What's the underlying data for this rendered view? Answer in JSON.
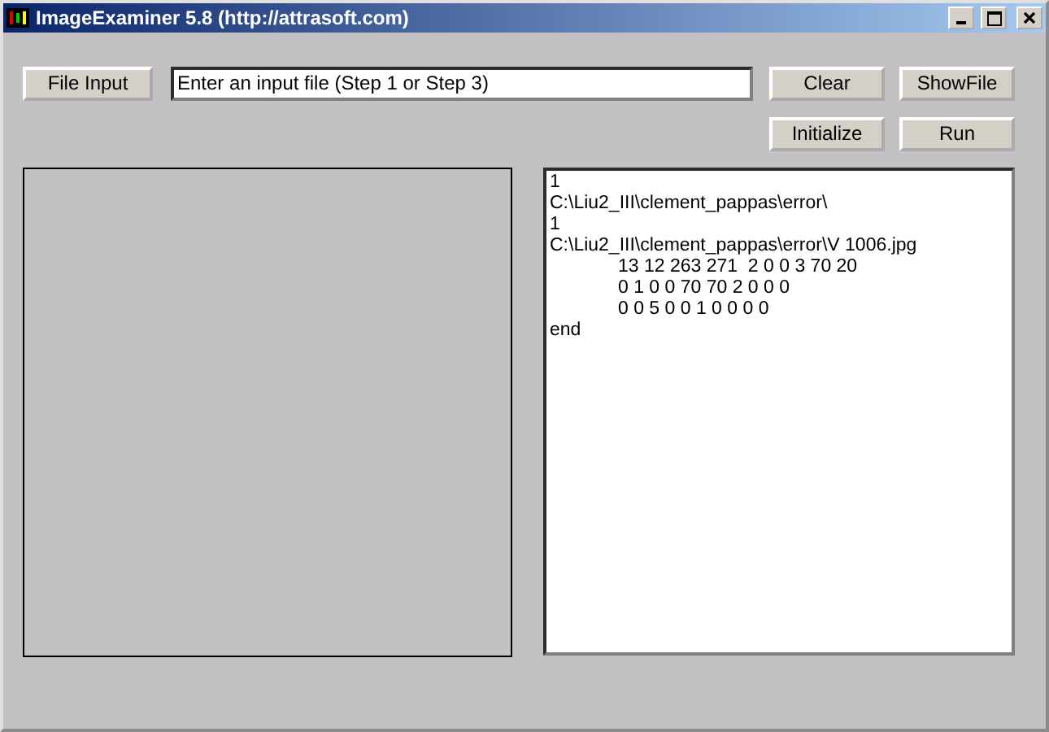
{
  "window": {
    "title": "ImageExaminer 5.8 (http://attrasoft.com)"
  },
  "file_input_button": "File Input",
  "input_field": {
    "value": "Enter an input file (Step 1 or Step 3)"
  },
  "buttons_row1": [
    "Clear",
    "ShowFile"
  ],
  "buttons_row2": [
    "Initialize",
    "Run"
  ],
  "output_lines": [
    {
      "text": "1",
      "kind": "plain"
    },
    {
      "text": "C:\\Liu2_III\\clement_pappas\\error\\",
      "kind": "plain"
    },
    {
      "text": "1",
      "kind": "plain"
    },
    {
      "text": "C:\\Liu2_III\\clement_pappas\\error\\V 1006.jpg",
      "kind": "plain"
    },
    {
      "text": "13 12 263 271  2 0 0 3 70 20",
      "kind": "indented"
    },
    {
      "text": "0 1 0 0 70 70 2 0 0 0",
      "kind": "indented"
    },
    {
      "text": "0 0 5 0 0 1 0 0 0 0",
      "kind": "indented"
    },
    {
      "text": "end",
      "kind": "plain"
    }
  ]
}
